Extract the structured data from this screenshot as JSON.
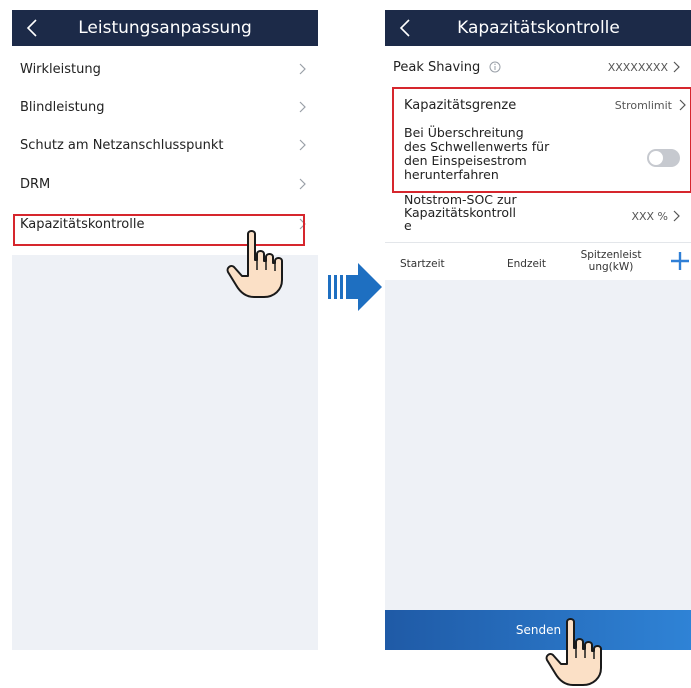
{
  "left_screen": {
    "title": "Leistungsanpassung",
    "items": [
      {
        "label": "Wirkleistung"
      },
      {
        "label": "Blindleistung"
      },
      {
        "label": "Schutz am Netzanschlusspunkt"
      },
      {
        "label": "DRM"
      },
      {
        "label": "Kapazitätskontrolle"
      }
    ]
  },
  "right_screen": {
    "title": "Kapazitätskontrolle",
    "peak_shaving": {
      "label": "Peak Shaving",
      "value": "XXXXXXXX"
    },
    "capacity_limit": {
      "label": "Kapazitätsgrenze",
      "value": "Stromlimit"
    },
    "shutdown": {
      "line1": "Bei Überschreitung",
      "line2": "des Schwellenwerts für",
      "line3": "den Einspeisestrom",
      "line4": "herunterfahren",
      "enabled": false
    },
    "backup_soc": {
      "line1": "Notstrom-SOC zur",
      "line2": "Kapazitätskontroll",
      "line3": "e",
      "value": "XXX %"
    },
    "table": {
      "col1": "Startzeit",
      "col2": "Endzeit",
      "col3_line1": "Spitzenleist",
      "col3_line2": "ung(kW)"
    },
    "send_label": "Senden"
  },
  "icons": {
    "back": "chevron-left-icon",
    "info": "info-icon",
    "plus": "plus-icon",
    "hand": "hand-pointer-icon",
    "arrow": "arrow-right-icon"
  },
  "colors": {
    "header": "#1c2a48",
    "highlight": "#d6262d",
    "accent": "#2f7fd6",
    "panel_bg": "#eef1f6"
  }
}
